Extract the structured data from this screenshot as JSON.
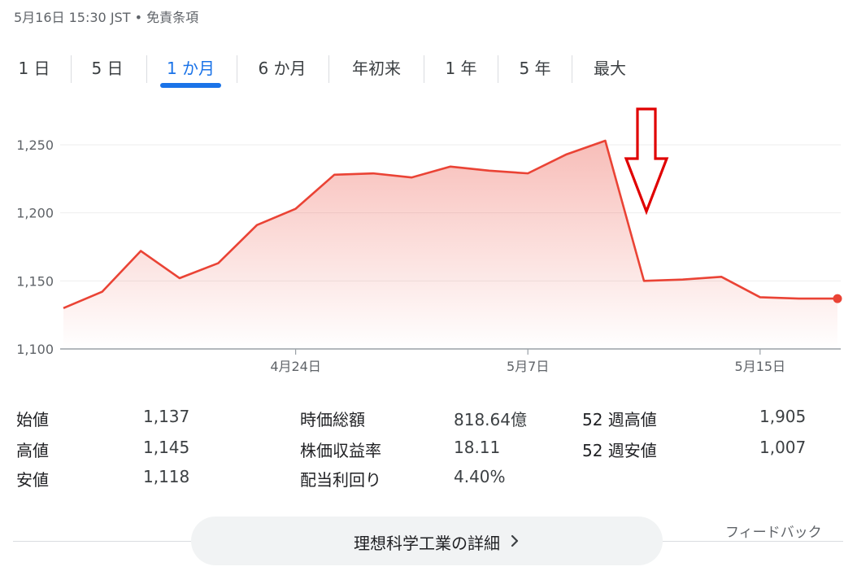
{
  "header": {
    "timestamp": "5月16日 15:30 JST",
    "separator": "•",
    "disclaimer_link": "免責条項"
  },
  "tabs": [
    {
      "label": "1 日",
      "active": false
    },
    {
      "label": "5 日",
      "active": false
    },
    {
      "label": "1 か月",
      "active": true
    },
    {
      "label": "6 か月",
      "active": false
    },
    {
      "label": "年初来",
      "active": false
    },
    {
      "label": "1 年",
      "active": false
    },
    {
      "label": "5 年",
      "active": false
    },
    {
      "label": "最大",
      "active": false
    }
  ],
  "chart_data": {
    "type": "area",
    "series": [
      {
        "values": [
          1130,
          1142,
          1172,
          1152,
          1163,
          1191,
          1203,
          1228,
          1229,
          1226,
          1234,
          1231,
          1229,
          1243,
          1253,
          1150,
          1151,
          1153,
          1138,
          1137,
          1137
        ]
      }
    ],
    "yticks": [
      "1,250",
      "1,200",
      "1,150",
      "1,100"
    ],
    "ytick_values": [
      1250,
      1200,
      1150,
      1100
    ],
    "ylim": [
      1100,
      1250
    ],
    "xticks": [
      {
        "label": "4月24日",
        "index": 6
      },
      {
        "label": "5月7日",
        "index": 12
      },
      {
        "label": "5月15日",
        "index": 18
      }
    ],
    "grid": true,
    "line_color": "#ea4335",
    "annotation": "down-arrow",
    "annotation_color": "#e00000"
  },
  "stats": {
    "col1": [
      {
        "label": "始値",
        "value": "1,137"
      },
      {
        "label": "高値",
        "value": "1,145"
      },
      {
        "label": "安値",
        "value": "1,118"
      }
    ],
    "col2": [
      {
        "label": "時価総額",
        "value": "818.64億"
      },
      {
        "label": "株価収益率",
        "value": "18.11"
      },
      {
        "label": "配当利回り",
        "value": "4.40%"
      }
    ],
    "col3": [
      {
        "label": "52 週高値",
        "value": "1,905"
      },
      {
        "label": "52 週安値",
        "value": "1,007"
      }
    ]
  },
  "footer": {
    "details_button": "理想科学工業の詳細",
    "details_icon": "chevron-right-icon",
    "feedback": "フィードバック"
  },
  "colors": {
    "accent": "#1a73e8",
    "chart_red": "#ea4335"
  }
}
